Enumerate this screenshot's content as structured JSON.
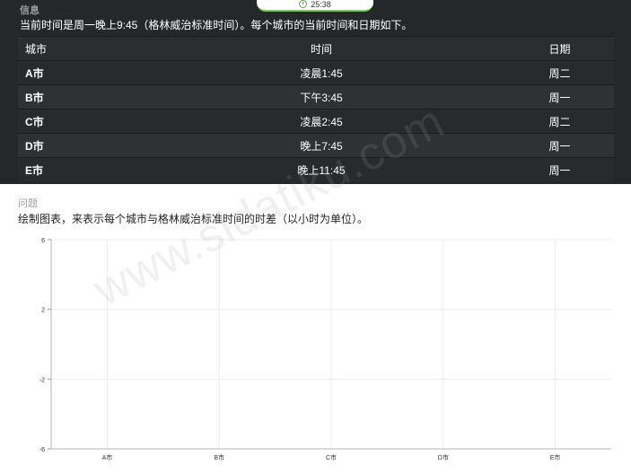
{
  "timer": {
    "value": "25:38"
  },
  "info": {
    "section_label": "信息",
    "text": "当前时间是周一晚上9:45（格林威治标准时间）。每个城市的当前时间和日期如下。",
    "table": {
      "headers": [
        "城市",
        "时间",
        "日期"
      ],
      "rows": [
        [
          "A市",
          "凌晨1:45",
          "周二"
        ],
        [
          "B市",
          "下午3:45",
          "周一"
        ],
        [
          "C市",
          "凌晨2:45",
          "周二"
        ],
        [
          "D市",
          "晚上7:45",
          "周一"
        ],
        [
          "E市",
          "晚上11:45",
          "周一"
        ]
      ]
    }
  },
  "question": {
    "section_label": "问题",
    "text": "绘制图表，来表示每个城市与格林威治标准时间的时差（以小时为单位）。"
  },
  "watermark": "www.sidatiku.com",
  "chart_data": {
    "type": "bar",
    "categories": [
      "A市",
      "B市",
      "C市",
      "D市",
      "E市"
    ],
    "values": [],
    "ylim": [
      -6,
      6
    ],
    "yticks": [
      "6",
      "2",
      "-2",
      "-6"
    ],
    "grid": true
  }
}
